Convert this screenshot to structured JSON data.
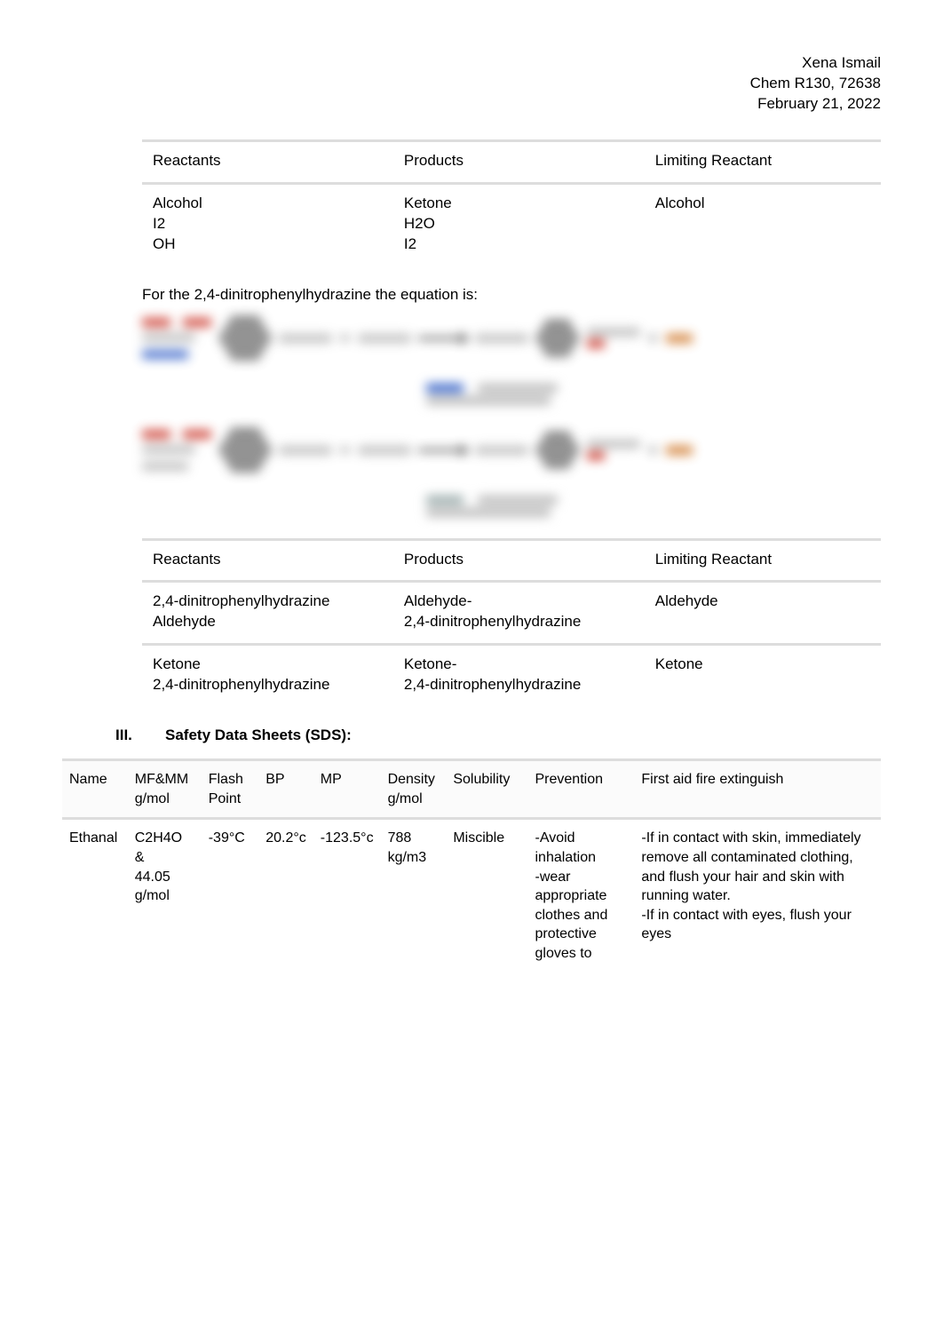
{
  "header": {
    "name": "Xena Ismail",
    "course": "Chem R130, 72638",
    "date": "February 21, 2022"
  },
  "table1": {
    "headers": [
      "Reactants",
      "Products",
      "Limiting Reactant"
    ],
    "row": {
      "reactants": "Alcohol\nI2\nOH",
      "products": "Ketone\nH2O\nI2",
      "limiting": "Alcohol"
    }
  },
  "caption": "For the 2,4-dinitrophenylhydrazine the equation is:",
  "table2": {
    "headers": [
      "Reactants",
      "Products",
      "Limiting Reactant"
    ],
    "rows": [
      {
        "reactants": "2,4-dinitrophenylhydrazine\nAldehyde",
        "products": "Aldehyde-\n2,4-dinitrophenylhydrazine",
        "limiting": "Aldehyde"
      },
      {
        "reactants": "Ketone\n2,4-dinitrophenylhydrazine",
        "products": "Ketone-\n2,4-dinitrophenylhydrazine",
        "limiting": "Ketone"
      }
    ]
  },
  "section": {
    "number": "III.",
    "title": "Safety Data Sheets (SDS):"
  },
  "sds": {
    "headers": [
      "Name",
      "MF&MM g/mol",
      "Flash Point",
      "BP",
      "MP",
      "Density g/mol",
      "Solubility",
      "Prevention",
      "First aid fire extinguish"
    ],
    "row": {
      "name": "Ethanal",
      "mf": "C2H4O\n&\n44.05\ng/mol",
      "flash": "-39°C",
      "bp": "20.2°c",
      "mp": "-123.5°c",
      "density": "788 kg/m3",
      "solubility": "Miscible",
      "prevention": "-Avoid inhalation\n-wear appropriate clothes and protective gloves to",
      "firstaid": "-If in contact with skin, immediately remove all contaminated clothing, and flush your hair and skin with running water.\n-If in contact with eyes, flush your eyes"
    }
  }
}
